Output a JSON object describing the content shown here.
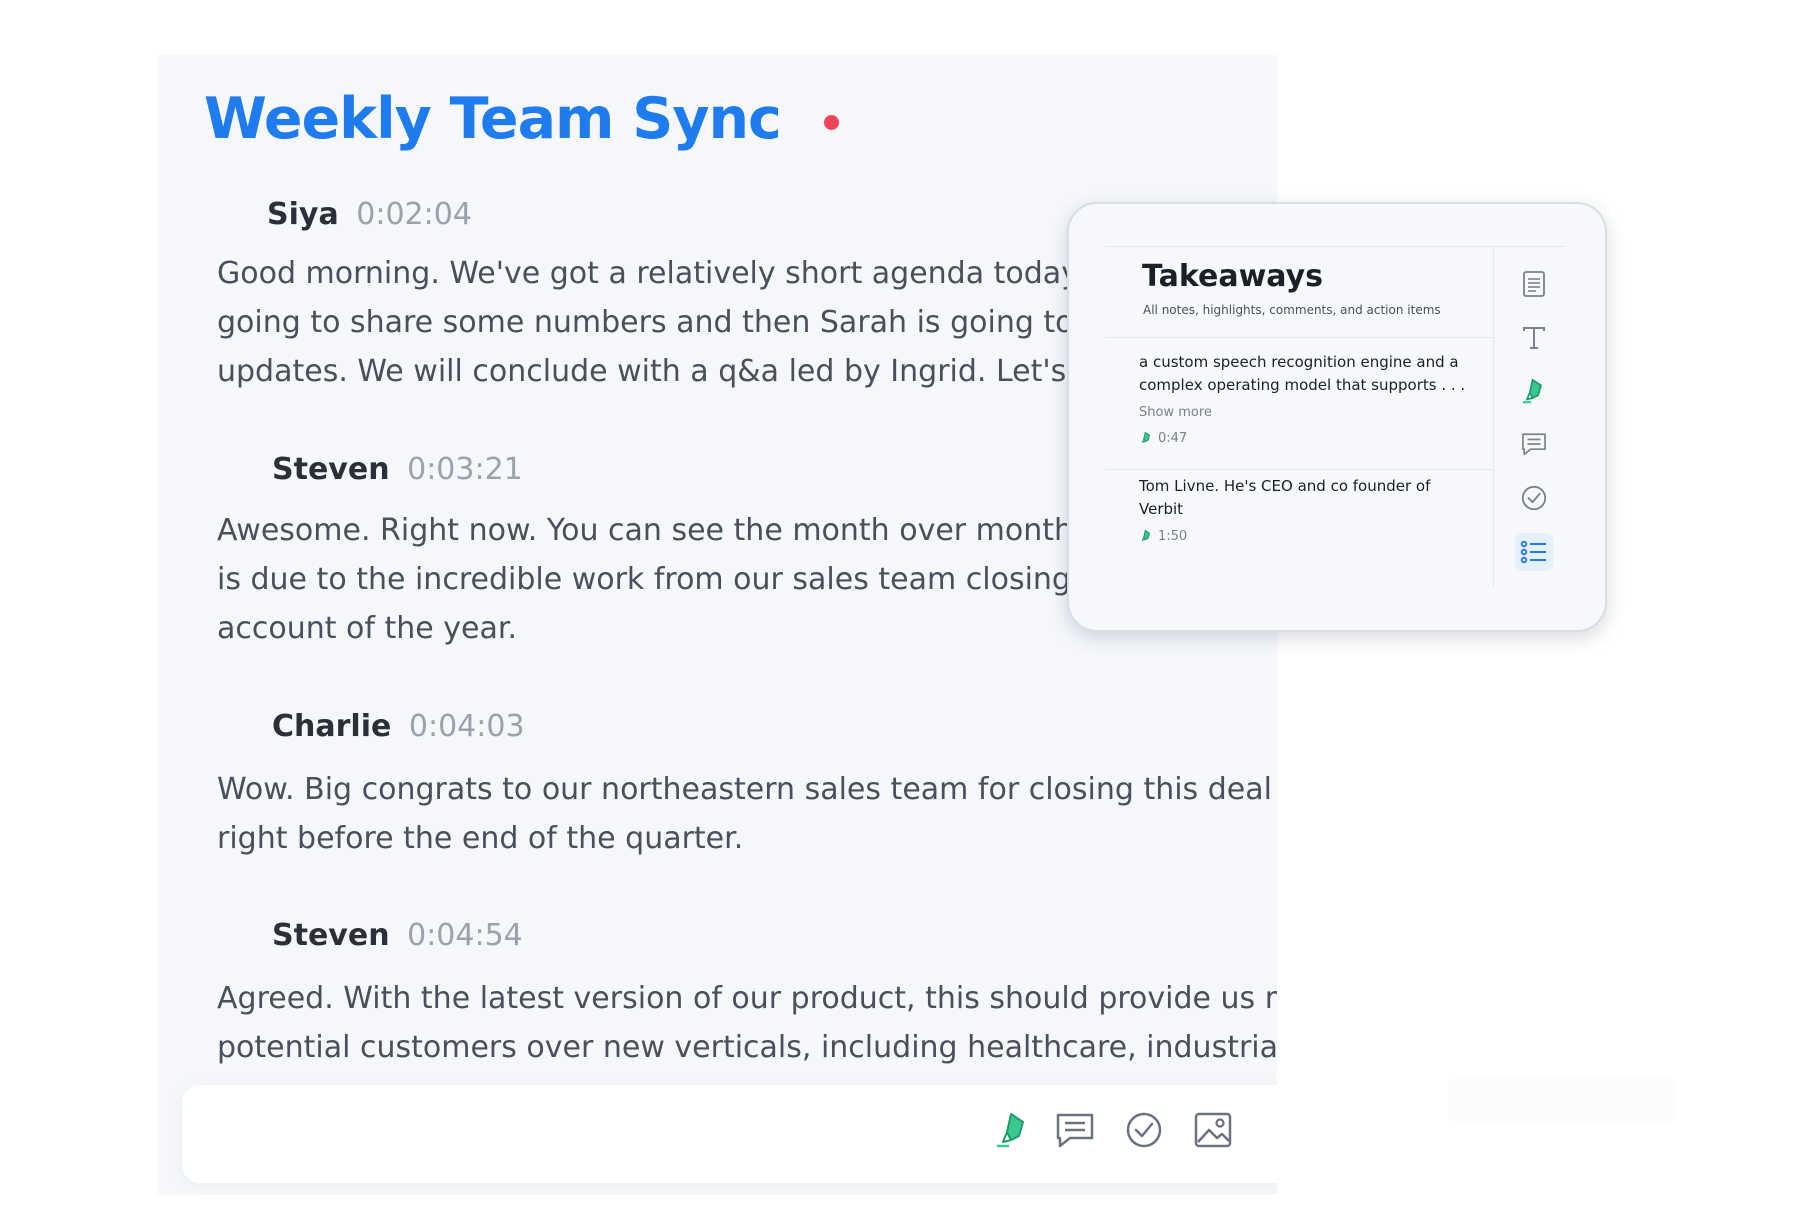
{
  "meeting": {
    "title": "Weekly Team Sync",
    "recording_indicator": "recording-dot",
    "colors": {
      "title": "#1f7cef",
      "recording": "#f0445a",
      "highlight": "#2cc28b",
      "accent": "#1f7cef"
    }
  },
  "transcript": [
    {
      "speaker": "Siya",
      "time": "0:02:04",
      "lines": [
        "Good morning. We've got a relatively short agenda today - T",
        "going to share some numbers and then Sarah is going to sho",
        "updates. We will conclude with a q&a led by Ingrid. Let's get"
      ]
    },
    {
      "speaker": "Steven",
      "time": "0:03:21",
      "lines": [
        "Awesome. Right now. You can see the month over month rise",
        "is due to the incredible work from our sales team closing the",
        "account of the year."
      ]
    },
    {
      "speaker": "Charlie",
      "time": "0:04:03",
      "lines": [
        "Wow. Big congrats to our northeastern sales team for closing this deal",
        "right before the end of the quarter."
      ]
    },
    {
      "speaker": "Steven",
      "time": "0:04:54",
      "lines": [
        "Agreed. With the latest version of our product, this should provide us more",
        "potential customers over new verticals, including healthcare, industrials"
      ]
    }
  ],
  "input_toolbar": {
    "tools": [
      "highlight-icon",
      "comment-icon",
      "action-item-icon",
      "image-icon"
    ]
  },
  "takeaways": {
    "title": "Takeaways",
    "subtitle": "All notes, highlights, comments, and action items",
    "items": [
      {
        "lines": [
          "a custom speech recognition engine and a",
          "complex operating model that supports . . ."
        ],
        "show_more": "Show more",
        "time": "0:47",
        "type_icon": "highlight-icon"
      },
      {
        "lines": [
          "Tom Livne. He's CEO and co founder of",
          "Verbit"
        ],
        "time": "1:50",
        "type_icon": "highlight-icon"
      }
    ],
    "side_icons": [
      "notes-icon",
      "text-icon",
      "highlight-icon",
      "comment-icon",
      "check-icon",
      "list-icon"
    ],
    "active_side_icon": "list-icon"
  }
}
